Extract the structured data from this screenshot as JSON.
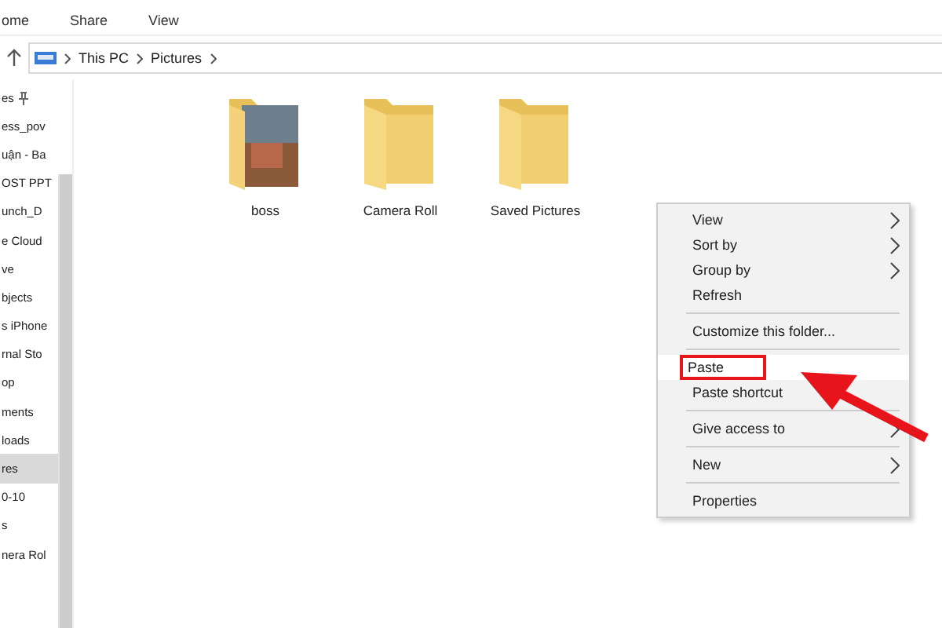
{
  "ribbon": {
    "tabs": [
      {
        "label": "ome",
        "selected": false
      },
      {
        "label": "Share",
        "selected": false
      },
      {
        "label": "View",
        "selected": false
      }
    ]
  },
  "address_bar": {
    "path": [
      "This PC",
      "Pictures"
    ]
  },
  "sidebar": {
    "items": [
      {
        "label": "es",
        "pinned": true,
        "selected": false
      },
      {
        "label": "ess_pov",
        "pinned": false,
        "selected": false
      },
      {
        "label": "uận - Ba",
        "pinned": false,
        "selected": false
      },
      {
        "label": "OST PPT",
        "pinned": false,
        "selected": false
      },
      {
        "label": "unch_D",
        "pinned": false,
        "selected": false
      },
      {
        "label": "e Cloud",
        "pinned": false,
        "selected": false
      },
      {
        "label": "ve",
        "pinned": false,
        "selected": false
      },
      {
        "label": "bjects",
        "pinned": false,
        "selected": false
      },
      {
        "label": "s iPhone",
        "pinned": false,
        "selected": false
      },
      {
        "label": "rnal Sto",
        "pinned": false,
        "selected": false
      },
      {
        "label": "op",
        "pinned": false,
        "selected": false
      },
      {
        "label": "ments",
        "pinned": false,
        "selected": false
      },
      {
        "label": "loads",
        "pinned": false,
        "selected": false
      },
      {
        "label": "res",
        "pinned": false,
        "selected": true
      },
      {
        "label": "0-10",
        "pinned": false,
        "selected": false
      },
      {
        "label": "s",
        "pinned": false,
        "selected": false
      },
      {
        "label": "nera Rol",
        "pinned": false,
        "selected": false
      }
    ]
  },
  "folders": [
    {
      "name": "boss",
      "kind": "photo"
    },
    {
      "name": "Camera Roll",
      "kind": "plain"
    },
    {
      "name": "Saved Pictures",
      "kind": "plain"
    }
  ],
  "context_menu": {
    "items": [
      {
        "kind": "item",
        "label": "View",
        "submenu": true,
        "selected": false,
        "callout": false
      },
      {
        "kind": "item",
        "label": "Sort by",
        "submenu": true,
        "selected": false,
        "callout": false
      },
      {
        "kind": "item",
        "label": "Group by",
        "submenu": true,
        "selected": false,
        "callout": false
      },
      {
        "kind": "item",
        "label": "Refresh",
        "submenu": false,
        "selected": false,
        "callout": false
      },
      {
        "kind": "separator"
      },
      {
        "kind": "item",
        "label": "Customize this folder...",
        "submenu": false,
        "selected": false,
        "callout": false
      },
      {
        "kind": "separator"
      },
      {
        "kind": "item",
        "label": "Paste",
        "submenu": false,
        "selected": true,
        "callout": true
      },
      {
        "kind": "item",
        "label": "Paste shortcut",
        "submenu": false,
        "selected": false,
        "callout": false
      },
      {
        "kind": "separator"
      },
      {
        "kind": "item",
        "label": "Give access to",
        "submenu": true,
        "selected": false,
        "callout": false
      },
      {
        "kind": "separator"
      },
      {
        "kind": "item",
        "label": "New",
        "submenu": true,
        "selected": false,
        "callout": false
      },
      {
        "kind": "separator"
      },
      {
        "kind": "item",
        "label": "Properties",
        "submenu": false,
        "selected": false,
        "callout": false
      }
    ]
  }
}
